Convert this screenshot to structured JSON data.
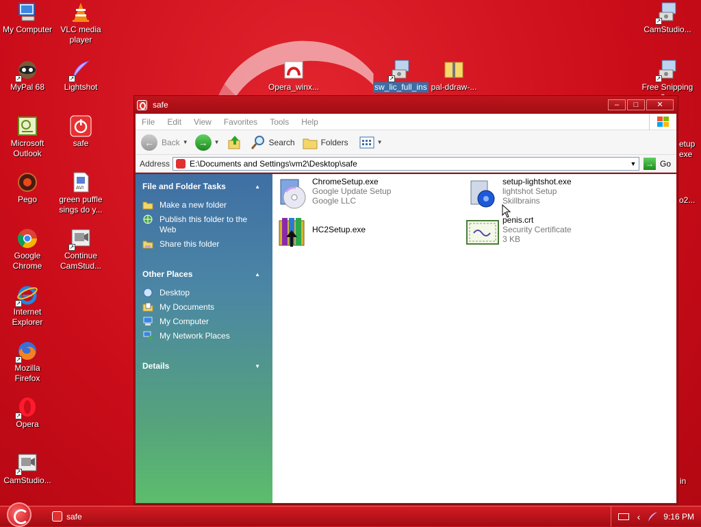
{
  "desktop": {
    "icons": [
      {
        "label": "My Computer"
      },
      {
        "label": "VLC media player"
      },
      {
        "label": "MyPal 68"
      },
      {
        "label": "Lightshot"
      },
      {
        "label": "Microsoft Outlook"
      },
      {
        "label": "safe"
      },
      {
        "label": "Pego"
      },
      {
        "label": "green puffle sings do y..."
      },
      {
        "label": "Google Chrome"
      },
      {
        "label": "Continue CamStud..."
      },
      {
        "label": "Internet Explorer"
      },
      {
        "label": "Mozilla Firefox"
      },
      {
        "label": "Opera"
      },
      {
        "label": "CamStudio..."
      },
      {
        "label": "Opera_winx..."
      },
      {
        "label": "sw_lic_full_ins"
      },
      {
        "label": "pal-ddraw-..."
      },
      {
        "label": "CamStudio..."
      },
      {
        "label": "Free Snipping 0...."
      }
    ],
    "partial_labels": [
      "etup",
      "exe",
      "o2...",
      "in"
    ]
  },
  "window": {
    "title": "safe",
    "menu": [
      "File",
      "Edit",
      "View",
      "Favorites",
      "Tools",
      "Help"
    ],
    "toolbar": {
      "back": "Back",
      "search": "Search",
      "folders": "Folders"
    },
    "address": {
      "label": "Address",
      "path": "E:\\Documents and Settings\\vm2\\Desktop\\safe",
      "go": "Go"
    },
    "taskpane": {
      "file_tasks": {
        "title": "File and Folder Tasks",
        "items": [
          "Make a new folder",
          "Publish this folder to the Web",
          "Share this folder"
        ]
      },
      "other_places": {
        "title": "Other Places",
        "items": [
          "Desktop",
          "My Documents",
          "My Computer",
          "My Network Places"
        ]
      },
      "details": {
        "title": "Details"
      }
    },
    "files": [
      {
        "name": "ChromeSetup.exe",
        "line2": "Google Update Setup",
        "line3": "Google LLC"
      },
      {
        "name": "setup-lightshot.exe",
        "line2": "lightshot Setup",
        "line3": "Skillbrains"
      },
      {
        "name": "HC2Setup.exe",
        "line2": "",
        "line3": ""
      },
      {
        "name": "penis.crt",
        "line2": "Security Certificate",
        "line3": "3 KB"
      }
    ]
  },
  "taskbar": {
    "task": "safe",
    "clock": "9:16 PM"
  }
}
